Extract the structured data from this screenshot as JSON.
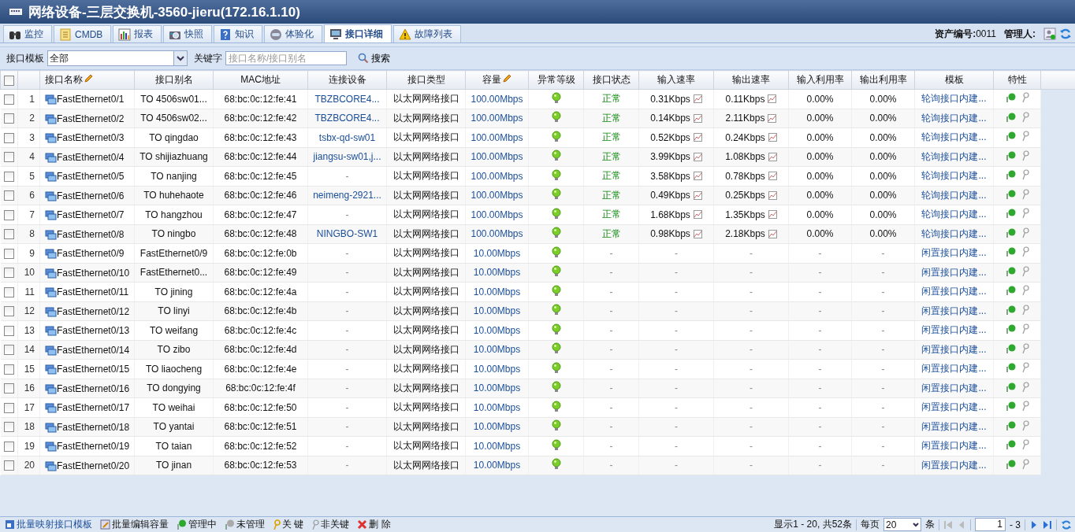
{
  "window": {
    "title": "网络设备-三层交换机-3560-jieru(172.16.1.10)"
  },
  "tabs": [
    {
      "label": "监控",
      "selected": false,
      "kind": "binoculars"
    },
    {
      "label": "CMDB",
      "selected": false,
      "kind": "document"
    },
    {
      "label": "报表",
      "selected": false,
      "kind": "chart"
    },
    {
      "label": "快照",
      "selected": false,
      "kind": "camera"
    },
    {
      "label": "知识",
      "selected": false,
      "kind": "question"
    },
    {
      "label": "体验化",
      "selected": false,
      "kind": "head"
    },
    {
      "label": "接口详细",
      "selected": true,
      "kind": "monitor"
    },
    {
      "label": "故障列表",
      "selected": false,
      "kind": "warning"
    }
  ],
  "asset": {
    "label": "资产编号:",
    "value": "0011",
    "manager_label": "管理人:"
  },
  "filter": {
    "template_label": "接口模板",
    "template_value": "全部",
    "keyword_label": "关键字",
    "keyword_placeholder": "接口名称/接口别名",
    "search_button": "搜索"
  },
  "table": {
    "select_all_checked": false,
    "columns": [
      "接口名称",
      "接口别名",
      "MAC地址",
      "连接设备",
      "接口类型",
      "容量",
      "异常等级",
      "接口状态",
      "输入速率",
      "输出速率",
      "输入利用率",
      "输出利用率",
      "模板",
      "特性"
    ],
    "rows": [
      {
        "no": "1",
        "name": "FastEthernet0/1",
        "alias": "TO 4506sw01...",
        "mac": "68:bc:0c:12:fe:41",
        "device": "TBZBCORE4...",
        "type": "以太网网络接口",
        "capacity": "100.00Mbps",
        "status": "正常",
        "in_rate": "0.31Kbps",
        "out_rate": "0.11Kbps",
        "in_util": "0.00%",
        "out_util": "0.00%",
        "template": "轮询接口内建...",
        "checked": false
      },
      {
        "no": "2",
        "name": "FastEthernet0/2",
        "alias": "TO 4506sw02...",
        "mac": "68:bc:0c:12:fe:42",
        "device": "TBZBCORE4...",
        "type": "以太网网络接口",
        "capacity": "100.00Mbps",
        "status": "正常",
        "in_rate": "0.14Kbps",
        "out_rate": "2.11Kbps",
        "in_util": "0.00%",
        "out_util": "0.00%",
        "template": "轮询接口内建...",
        "checked": false
      },
      {
        "no": "3",
        "name": "FastEthernet0/3",
        "alias": "TO qingdao",
        "mac": "68:bc:0c:12:fe:43",
        "device": "tsbx-qd-sw01",
        "type": "以太网网络接口",
        "capacity": "100.00Mbps",
        "status": "正常",
        "in_rate": "0.52Kbps",
        "out_rate": "0.24Kbps",
        "in_util": "0.00%",
        "out_util": "0.00%",
        "template": "轮询接口内建...",
        "checked": false
      },
      {
        "no": "4",
        "name": "FastEthernet0/4",
        "alias": "TO shijiazhuang",
        "mac": "68:bc:0c:12:fe:44",
        "device": "jiangsu-sw01,j...",
        "type": "以太网网络接口",
        "capacity": "100.00Mbps",
        "status": "正常",
        "in_rate": "3.99Kbps",
        "out_rate": "1.08Kbps",
        "in_util": "0.00%",
        "out_util": "0.00%",
        "template": "轮询接口内建...",
        "checked": false
      },
      {
        "no": "5",
        "name": "FastEthernet0/5",
        "alias": "TO nanjing",
        "mac": "68:bc:0c:12:fe:45",
        "device": "-",
        "type": "以太网网络接口",
        "capacity": "100.00Mbps",
        "status": "正常",
        "in_rate": "3.58Kbps",
        "out_rate": "0.78Kbps",
        "in_util": "0.00%",
        "out_util": "0.00%",
        "template": "轮询接口内建...",
        "checked": false
      },
      {
        "no": "6",
        "name": "FastEthernet0/6",
        "alias": "TO huhehaote",
        "mac": "68:bc:0c:12:fe:46",
        "device": "neimeng-2921...",
        "type": "以太网网络接口",
        "capacity": "100.00Mbps",
        "status": "正常",
        "in_rate": "0.49Kbps",
        "out_rate": "0.25Kbps",
        "in_util": "0.00%",
        "out_util": "0.00%",
        "template": "轮询接口内建...",
        "checked": false
      },
      {
        "no": "7",
        "name": "FastEthernet0/7",
        "alias": "TO hangzhou",
        "mac": "68:bc:0c:12:fe:47",
        "device": "-",
        "type": "以太网网络接口",
        "capacity": "100.00Mbps",
        "status": "正常",
        "in_rate": "1.68Kbps",
        "out_rate": "1.35Kbps",
        "in_util": "0.00%",
        "out_util": "0.00%",
        "template": "轮询接口内建...",
        "checked": false
      },
      {
        "no": "8",
        "name": "FastEthernet0/8",
        "alias": "TO ningbo",
        "mac": "68:bc:0c:12:fe:48",
        "device": "NINGBO-SW1",
        "type": "以太网网络接口",
        "capacity": "100.00Mbps",
        "status": "正常",
        "in_rate": "0.98Kbps",
        "out_rate": "2.18Kbps",
        "in_util": "0.00%",
        "out_util": "0.00%",
        "template": "轮询接口内建...",
        "checked": false
      },
      {
        "no": "9",
        "name": "FastEthernet0/9",
        "alias": "FastEthernet0/9",
        "mac": "68:bc:0c:12:fe:0b",
        "device": "-",
        "type": "以太网网络接口",
        "capacity": "10.00Mbps",
        "status": "-",
        "in_rate": "-",
        "out_rate": "-",
        "in_util": "-",
        "out_util": "-",
        "template": "闲置接口内建...",
        "checked": false
      },
      {
        "no": "10",
        "name": "FastEthernet0/10",
        "alias": "FastEthernet0...",
        "mac": "68:bc:0c:12:fe:49",
        "device": "-",
        "type": "以太网网络接口",
        "capacity": "10.00Mbps",
        "status": "-",
        "in_rate": "-",
        "out_rate": "-",
        "in_util": "-",
        "out_util": "-",
        "template": "闲置接口内建...",
        "checked": false
      },
      {
        "no": "11",
        "name": "FastEthernet0/11",
        "alias": "TO jining",
        "mac": "68:bc:0c:12:fe:4a",
        "device": "-",
        "type": "以太网网络接口",
        "capacity": "10.00Mbps",
        "status": "-",
        "in_rate": "-",
        "out_rate": "-",
        "in_util": "-",
        "out_util": "-",
        "template": "闲置接口内建...",
        "checked": false
      },
      {
        "no": "12",
        "name": "FastEthernet0/12",
        "alias": "TO linyi",
        "mac": "68:bc:0c:12:fe:4b",
        "device": "-",
        "type": "以太网网络接口",
        "capacity": "10.00Mbps",
        "status": "-",
        "in_rate": "-",
        "out_rate": "-",
        "in_util": "-",
        "out_util": "-",
        "template": "闲置接口内建...",
        "checked": false
      },
      {
        "no": "13",
        "name": "FastEthernet0/13",
        "alias": "TO weifang",
        "mac": "68:bc:0c:12:fe:4c",
        "device": "-",
        "type": "以太网网络接口",
        "capacity": "10.00Mbps",
        "status": "-",
        "in_rate": "-",
        "out_rate": "-",
        "in_util": "-",
        "out_util": "-",
        "template": "闲置接口内建...",
        "checked": false
      },
      {
        "no": "14",
        "name": "FastEthernet0/14",
        "alias": "TO zibo",
        "mac": "68:bc:0c:12:fe:4d",
        "device": "-",
        "type": "以太网网络接口",
        "capacity": "10.00Mbps",
        "status": "-",
        "in_rate": "-",
        "out_rate": "-",
        "in_util": "-",
        "out_util": "-",
        "template": "闲置接口内建...",
        "checked": false
      },
      {
        "no": "15",
        "name": "FastEthernet0/15",
        "alias": "TO liaocheng",
        "mac": "68:bc:0c:12:fe:4e",
        "device": "-",
        "type": "以太网网络接口",
        "capacity": "10.00Mbps",
        "status": "-",
        "in_rate": "-",
        "out_rate": "-",
        "in_util": "-",
        "out_util": "-",
        "template": "闲置接口内建...",
        "checked": false
      },
      {
        "no": "16",
        "name": "FastEthernet0/16",
        "alias": "TO dongying",
        "mac": "68:bc:0c:12:fe:4f",
        "device": "-",
        "type": "以太网网络接口",
        "capacity": "10.00Mbps",
        "status": "-",
        "in_rate": "-",
        "out_rate": "-",
        "in_util": "-",
        "out_util": "-",
        "template": "闲置接口内建...",
        "checked": false
      },
      {
        "no": "17",
        "name": "FastEthernet0/17",
        "alias": "TO weihai",
        "mac": "68:bc:0c:12:fe:50",
        "device": "-",
        "type": "以太网网络接口",
        "capacity": "10.00Mbps",
        "status": "-",
        "in_rate": "-",
        "out_rate": "-",
        "in_util": "-",
        "out_util": "-",
        "template": "闲置接口内建...",
        "checked": false
      },
      {
        "no": "18",
        "name": "FastEthernet0/18",
        "alias": "TO yantai",
        "mac": "68:bc:0c:12:fe:51",
        "device": "-",
        "type": "以太网网络接口",
        "capacity": "10.00Mbps",
        "status": "-",
        "in_rate": "-",
        "out_rate": "-",
        "in_util": "-",
        "out_util": "-",
        "template": "闲置接口内建...",
        "checked": false
      },
      {
        "no": "19",
        "name": "FastEthernet0/19",
        "alias": "TO taian",
        "mac": "68:bc:0c:12:fe:52",
        "device": "-",
        "type": "以太网网络接口",
        "capacity": "10.00Mbps",
        "status": "-",
        "in_rate": "-",
        "out_rate": "-",
        "in_util": "-",
        "out_util": "-",
        "template": "闲置接口内建...",
        "checked": false
      },
      {
        "no": "20",
        "name": "FastEthernet0/20",
        "alias": "TO jinan",
        "mac": "68:bc:0c:12:fe:53",
        "device": "-",
        "type": "以太网网络接口",
        "capacity": "10.00Mbps",
        "status": "-",
        "in_rate": "-",
        "out_rate": "-",
        "in_util": "-",
        "out_util": "-",
        "template": "闲置接口内建...",
        "checked": false
      }
    ]
  },
  "footer": {
    "actions": [
      {
        "label": "批量映射接口模板",
        "kind": "template"
      },
      {
        "label": "批量编辑容量",
        "kind": "edit"
      },
      {
        "label": "管理中",
        "kind": "managed"
      },
      {
        "label": "未管理",
        "kind": "unmanaged"
      },
      {
        "label": "关 键",
        "kind": "key"
      },
      {
        "label": "非关键",
        "kind": "nonkey"
      },
      {
        "label": "删 除",
        "kind": "delete"
      }
    ],
    "summary": "显示1 - 20, 共52条",
    "per_page_label": "每页",
    "per_page": "20",
    "per_page_unit": "条",
    "page": "1",
    "page_total": "- 3"
  }
}
